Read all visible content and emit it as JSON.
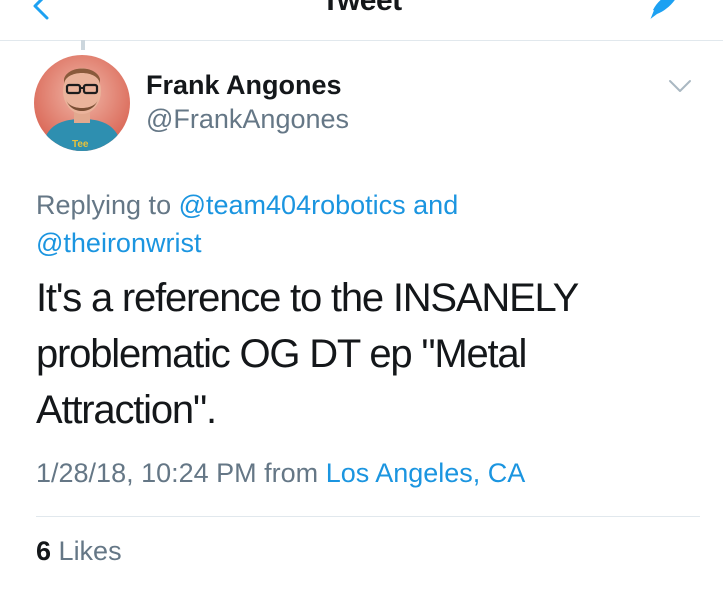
{
  "nav": {
    "title": "Tweet",
    "back_icon": "chevron-left-icon",
    "compose_icon": "compose-feather-icon",
    "accent": "#1da1f2"
  },
  "tweet": {
    "author_name": "Frank Angones",
    "author_handle": "@FrankAngones",
    "menu_icon": "chevron-down-icon",
    "replying_prefix": "Replying to",
    "reply_mention_1": "@team404robotics",
    "reply_and": "and",
    "reply_mention_2": "@theironwrist",
    "text_lines": [
      "It's a reference to the INSANELY",
      "problematic OG DT ep \"Metal",
      "Attraction\"."
    ],
    "timestamp": "1/28/18, 10:24 PM",
    "from_label": "from",
    "location": "Los Angeles, CA",
    "likes_count": "6",
    "likes_label": "Likes",
    "link_color": "#1b95e0",
    "secondary_color": "#657786"
  }
}
